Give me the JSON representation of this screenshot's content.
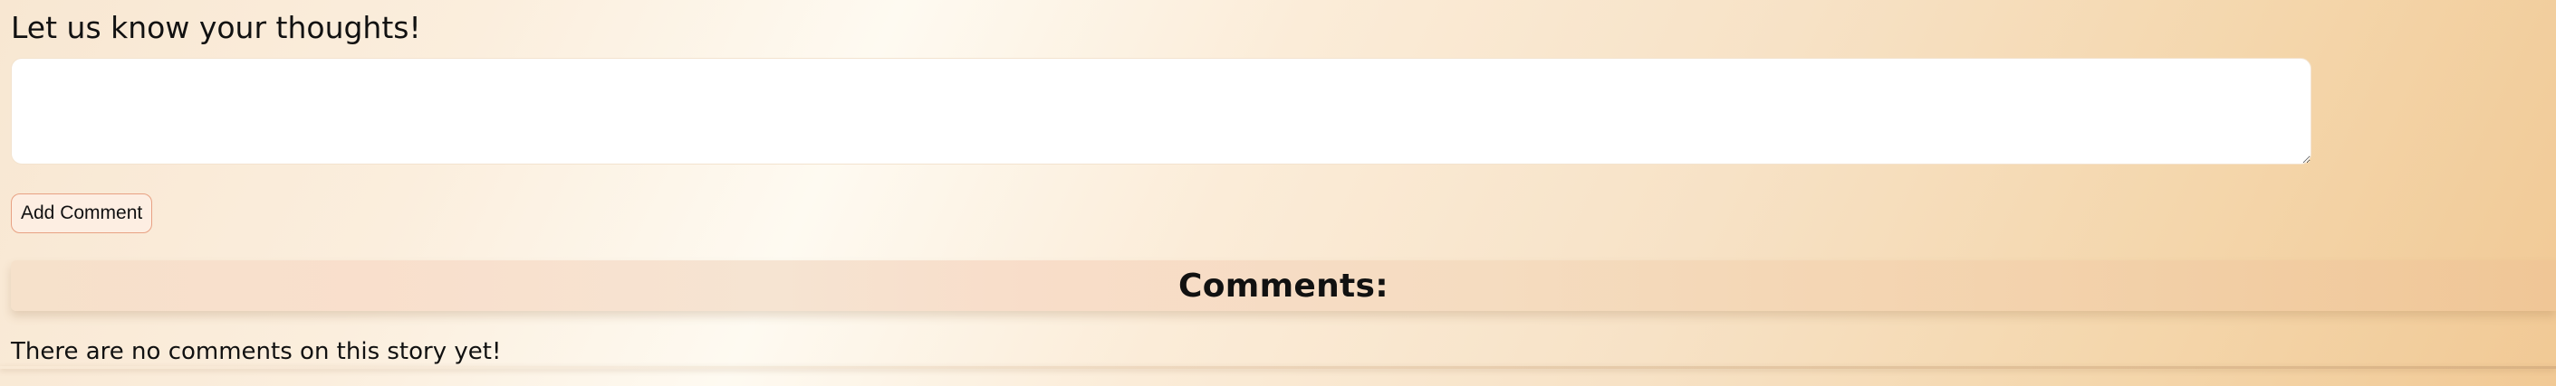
{
  "comment_form": {
    "prompt": "Let us know your thoughts!",
    "textarea_value": "",
    "textarea_placeholder": "",
    "submit_label": "Add Comment"
  },
  "comments": {
    "heading": "Comments:",
    "empty_message": "There are no comments on this story yet!"
  }
}
